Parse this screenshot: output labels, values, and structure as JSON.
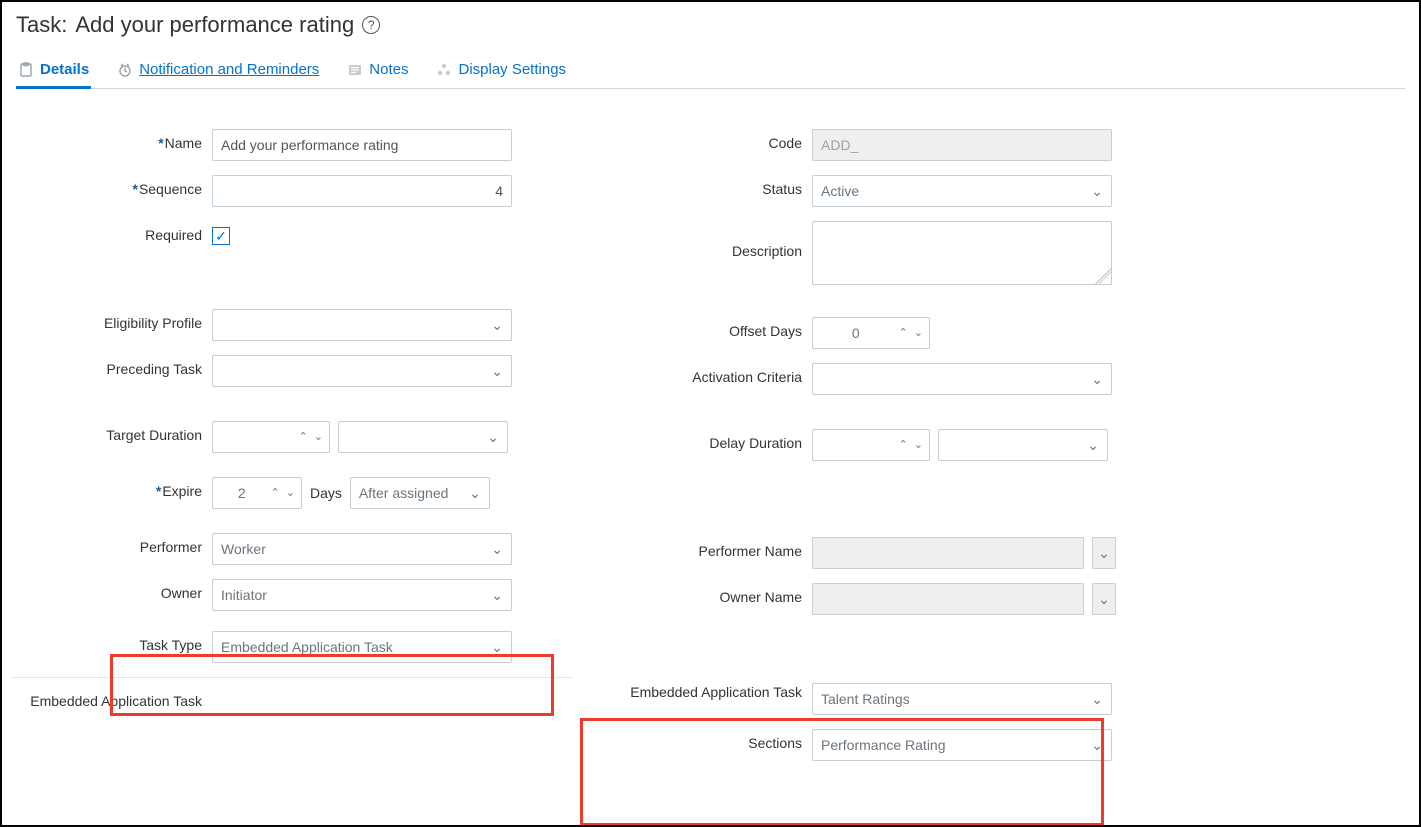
{
  "header": {
    "title_prefix": "Task:",
    "title_name": "Add your performance rating"
  },
  "tabs": {
    "details": "Details",
    "notifications": "Notification and Reminders",
    "notes": "Notes",
    "display": "Display Settings"
  },
  "labels": {
    "name": "Name",
    "sequence": "Sequence",
    "required": "Required",
    "eligibility": "Eligibility Profile",
    "preceding": "Preceding Task",
    "target_duration": "Target Duration",
    "expire": "Expire",
    "days": "Days",
    "performer": "Performer",
    "owner": "Owner",
    "task_type": "Task Type",
    "embedded_app_task_left": "Embedded Application Task",
    "code": "Code",
    "status": "Status",
    "description": "Description",
    "offset_days": "Offset Days",
    "activation_criteria": "Activation Criteria",
    "delay_duration": "Delay Duration",
    "performer_name": "Performer Name",
    "owner_name": "Owner Name",
    "embedded_app_task_right": "Embedded Application Task",
    "sections": "Sections"
  },
  "values": {
    "name": "Add your performance rating",
    "sequence": "4",
    "required_checked": "✓",
    "code": "ADD_",
    "status": "Active",
    "description": "",
    "eligibility": "",
    "preceding": "",
    "offset_days": "0",
    "activation_criteria": "",
    "target_duration_num": "",
    "target_duration_unit": "",
    "delay_duration_num": "",
    "delay_duration_unit": "",
    "expire_num": "2",
    "expire_basis": "After assigned",
    "performer": "Worker",
    "owner": "Initiator",
    "performer_name": "",
    "owner_name": "",
    "task_type": "Embedded Application Task",
    "embedded_app_task": "Talent Ratings",
    "sections": "Performance Rating"
  }
}
